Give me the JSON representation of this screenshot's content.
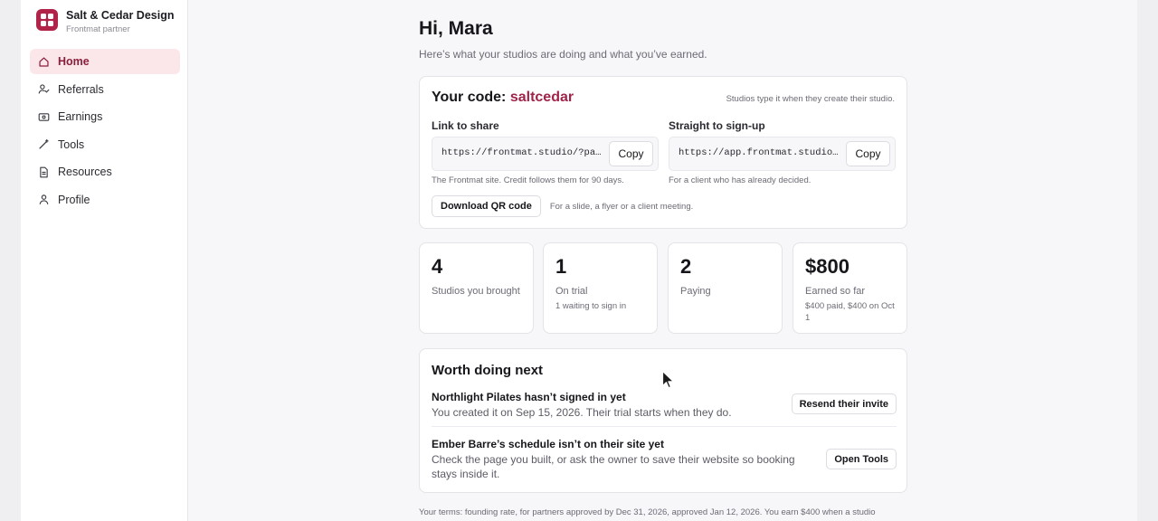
{
  "sidebar": {
    "brand_name": "Salt & Cedar Design",
    "brand_sub": "Frontmat partner",
    "items": [
      {
        "label": "Home",
        "icon": "home-icon",
        "active": true
      },
      {
        "label": "Referrals",
        "icon": "user-check-icon"
      },
      {
        "label": "Earnings",
        "icon": "banknote-icon"
      },
      {
        "label": "Tools",
        "icon": "wand-icon"
      },
      {
        "label": "Resources",
        "icon": "document-icon"
      },
      {
        "label": "Profile",
        "icon": "user-icon"
      }
    ]
  },
  "main": {
    "greeting": "Hi, Mara",
    "lede": "Here’s what your studios are doing and what you’ve earned.",
    "code": {
      "title_prefix": "Your code:",
      "value": "saltcedar",
      "hint": "Studios type it when they create their studio.",
      "share": {
        "label": "Link to share",
        "url": "https://frontmat.studio/?pa…",
        "copy_label": "Copy",
        "note": "The Frontmat site. Credit follows them for 90 days."
      },
      "signup": {
        "label": "Straight to sign-up",
        "url": "https://app.frontmat.studio…",
        "copy_label": "Copy",
        "note": "For a client who has already decided."
      },
      "qr_label": "Download QR code",
      "qr_note": "For a slide, a flyer or a client meeting."
    },
    "stats": [
      {
        "value": "4",
        "label": "Studios you brought",
        "sub": ""
      },
      {
        "value": "1",
        "label": "On trial",
        "sub": "1 waiting to sign in"
      },
      {
        "value": "2",
        "label": "Paying",
        "sub": ""
      },
      {
        "value": "$800",
        "label": "Earned so far",
        "sub": "$400 paid, $400 on Oct 1"
      }
    ],
    "next": {
      "title": "Worth doing next",
      "tasks": [
        {
          "title": "Northlight Pilates hasn’t signed in yet",
          "desc": "You created it on Sep 15, 2026. Their trial starts when they do.",
          "action": "Resend their invite"
        },
        {
          "title": "Ember Barre’s schedule isn’t on their site yet",
          "desc": "Check the page you built, or ask the owner to save their website so booking stays inside it.",
          "action": "Open Tools"
        }
      ]
    },
    "terms": "Your terms: founding rate, for partners approved by Dec 31, 2026, approved Jan 12, 2026. You earn $400 when a studio"
  },
  "colors": {
    "accent": "#a0244a",
    "active_bg": "#fbe7ea",
    "logo": "#b2234a"
  }
}
